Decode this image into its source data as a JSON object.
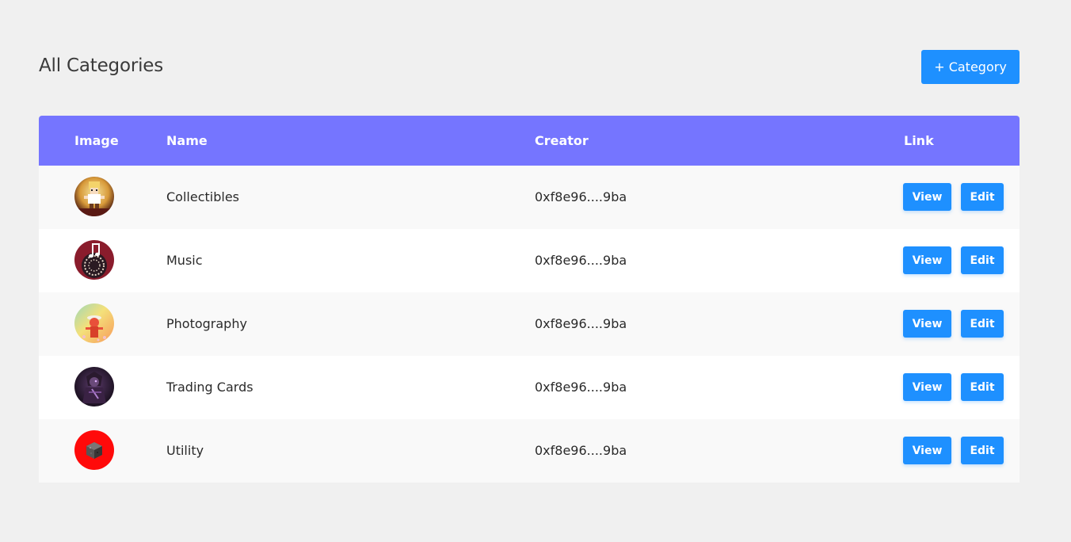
{
  "header": {
    "title": "All Categories",
    "add_button_label": "+ Category"
  },
  "table": {
    "columns": [
      "Image",
      "Name",
      "Creator",
      "Link"
    ],
    "rows": [
      {
        "name": "Collectibles",
        "creator": "0xf8e96....9ba",
        "view_label": "View",
        "edit_label": "Edit",
        "image": "pixel-character-avatar"
      },
      {
        "name": "Music",
        "creator": "0xf8e96....9ba",
        "view_label": "View",
        "edit_label": "Edit",
        "image": "music-note-avatar"
      },
      {
        "name": "Photography",
        "creator": "0xf8e96....9ba",
        "view_label": "View",
        "edit_label": "Edit",
        "image": "figure-gradient-avatar"
      },
      {
        "name": "Trading Cards",
        "creator": "0xf8e96....9ba",
        "view_label": "View",
        "edit_label": "Edit",
        "image": "dark-figure-avatar"
      },
      {
        "name": "Utility",
        "creator": "0xf8e96....9ba",
        "view_label": "View",
        "edit_label": "Edit",
        "image": "red-cube-avatar"
      }
    ]
  },
  "colors": {
    "background": "#f0f0f0",
    "header_bg": "#7575ff",
    "button_bg": "#1e90ff",
    "row_odd": "#f9f9f9",
    "row_even": "#ffffff"
  }
}
